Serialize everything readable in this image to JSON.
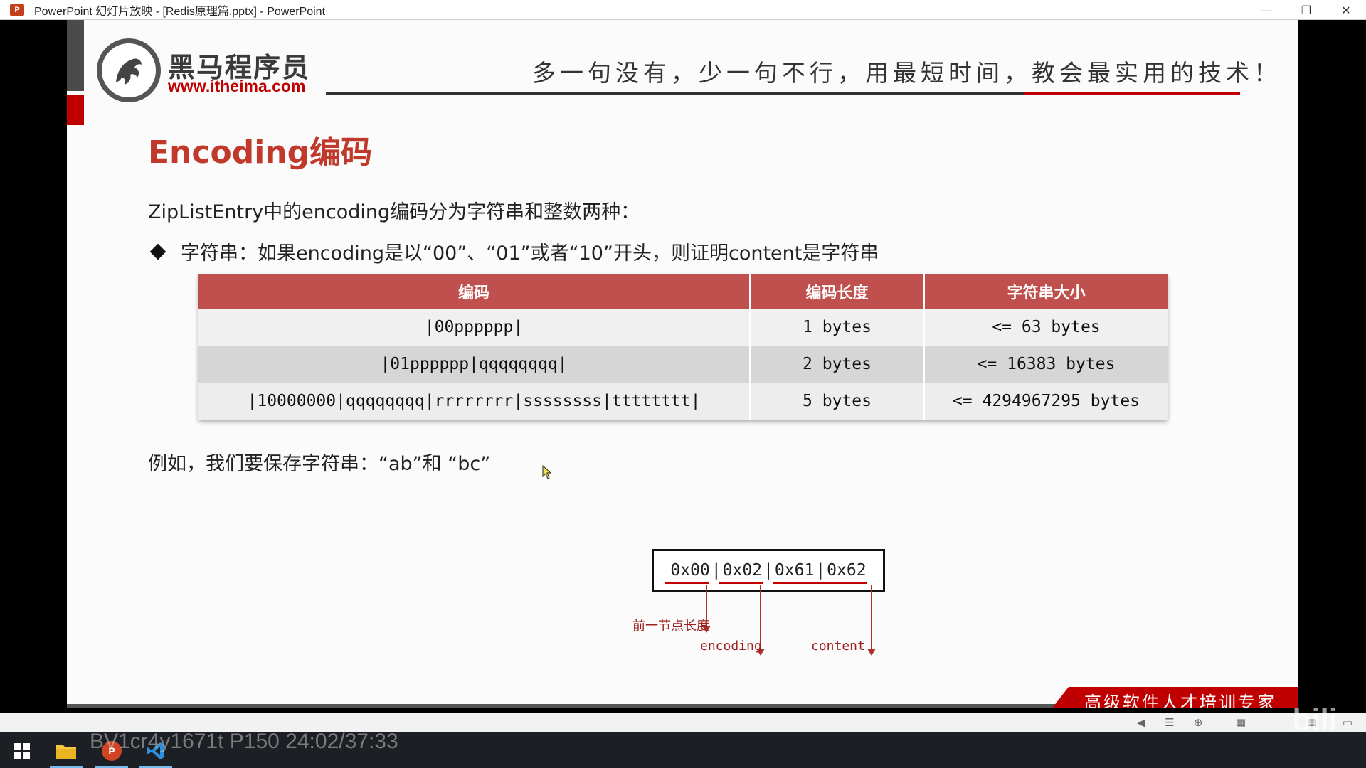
{
  "window": {
    "title": "PowerPoint 幻灯片放映 - [Redis原理篇.pptx] - PowerPoint",
    "app_icon": "P",
    "controls": {
      "minimize": "—",
      "restore": "❐",
      "close": "✕"
    }
  },
  "slide": {
    "logo": {
      "name": "黑马程序员",
      "url": "www.itheima.com"
    },
    "slogan": "多一句没有，少一句不行，用最短时间，教会最实用的技术！",
    "title": "Encoding编码",
    "intro": "ZipListEntry中的encoding编码分为字符串和整数两种：",
    "bullet": "字符串：如果encoding是以“00”、“01”或者“10”开头，则证明content是字符串",
    "table": {
      "headers": [
        "编码",
        "编码长度",
        "字符串大小"
      ],
      "rows": [
        [
          "|00pppppp|",
          "1 bytes",
          "<= 63 bytes"
        ],
        [
          "|01pppppp|qqqqqqqq|",
          "2 bytes",
          "<= 16383 bytes"
        ],
        [
          "|10000000|qqqqqqqq|rrrrrrrr|ssssssss|tttttttt|",
          "5 bytes",
          "<= 4294967295 bytes"
        ]
      ]
    },
    "example": "例如，我们要保存字符串：“ab”和 “bc”",
    "bytes": [
      "0x00",
      "0x02",
      "0x61",
      "0x62"
    ],
    "annotations": {
      "prev_len": "前一节点长度",
      "encoding": "encoding",
      "content": "content"
    },
    "footer": "高级软件人才培训专家"
  },
  "overlay": {
    "watermark": "BV1cr4y1671t P150 24:02/37:33",
    "site_mark": "bili"
  },
  "colors": {
    "accent_red": "#c00000",
    "table_header": "#c0504d",
    "title_red": "#c0392b"
  }
}
